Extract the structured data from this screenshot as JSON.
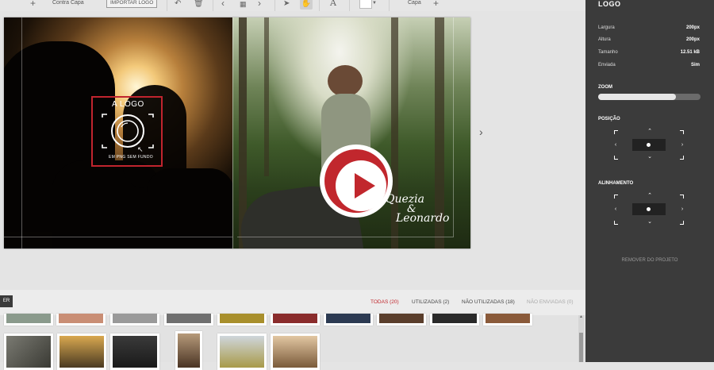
{
  "toolbar": {
    "back_cover_label": "Contra Capa",
    "import_logo_label": "IMPORTAR LOGO",
    "cover_label": "Capa",
    "icons": [
      "plus-icon",
      "undo-icon",
      "trash-icon",
      "chevron-left-icon",
      "grid-icon",
      "chevron-right-icon",
      "cursor-icon",
      "hand-icon",
      "text-icon",
      "color-swatch",
      "plus-icon"
    ]
  },
  "canvas": {
    "logo_placeholder_top": "A LOGO",
    "logo_placeholder_bottom": "EM PNG SEM FUNDO",
    "couple_name_1": "Quezia",
    "couple_ampersand": "&",
    "couple_name_2": "Leonardo"
  },
  "panel": {
    "title": "LOGO",
    "info": [
      {
        "label": "Largura",
        "value": "200px"
      },
      {
        "label": "Altura",
        "value": "200px"
      },
      {
        "label": "Tamanho",
        "value": "12.51 kB"
      },
      {
        "label": "Enviada",
        "value": "Sim"
      }
    ],
    "zoom_label": "ZOOM",
    "zoom_level": 0.76,
    "position_label": "POSIÇÃO",
    "alignment_label": "ALINHAMENTO",
    "remove_label": "REMOVER DO PROJETO"
  },
  "filters": {
    "collapsed_button": "ER",
    "all": "TODAS (20)",
    "used": "UTILIZADAS (2)",
    "unused": "NÃO UTILIZADAS (18)",
    "not_uploaded": "NÃO ENVIADAS (0)"
  },
  "colors": {
    "accent_red": "#c1272d",
    "panel_bg": "#3b3b3b"
  }
}
